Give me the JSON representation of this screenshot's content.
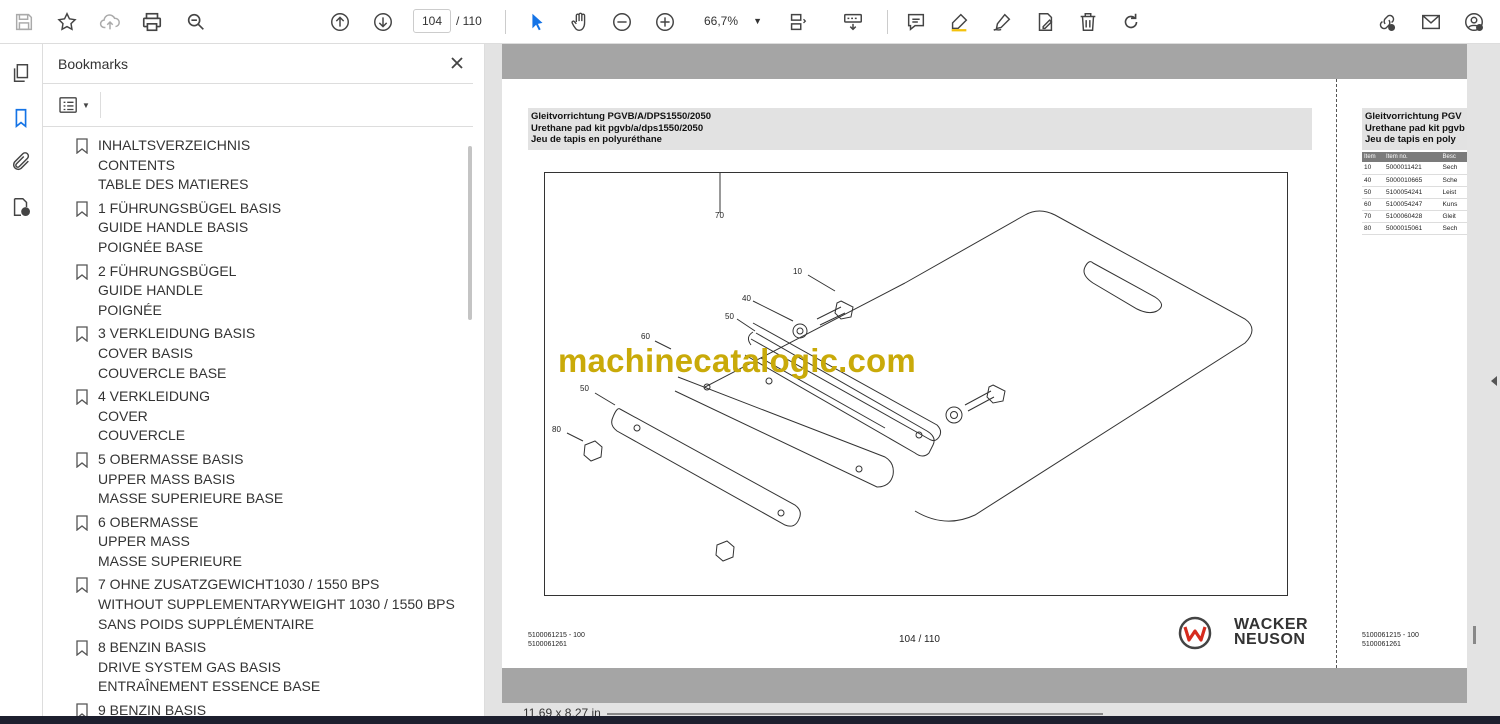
{
  "toolbar": {
    "page_current": "104",
    "page_total": "/  110",
    "zoom": "66,7%",
    "icons": [
      "save-icon",
      "star-icon",
      "cloud-upload-icon",
      "print-icon",
      "zoom-search-icon",
      "page-up-icon",
      "page-down-icon",
      "select-cursor-icon",
      "hand-icon",
      "zoom-out-icon",
      "zoom-in-icon",
      "fit-page-icon",
      "scroll-mode-icon",
      "comment-icon",
      "highlight-icon",
      "sign-icon",
      "edit-text-icon",
      "delete-icon",
      "rotate-icon",
      "link-share-icon",
      "mail-icon",
      "account-icon"
    ]
  },
  "left_rail": {
    "icons": [
      "pages-icon",
      "bookmark-icon",
      "attachment-icon",
      "document-security-icon"
    ]
  },
  "bookmarks_panel": {
    "title": "Bookmarks",
    "items": [
      {
        "lines": [
          "INHALTSVERZEICHNIS",
          "CONTENTS",
          "TABLE DES MATIERES"
        ]
      },
      {
        "lines": [
          "1 FÜHRUNGSBÜGEL BASIS",
          "GUIDE HANDLE BASIS",
          "POIGNÉE BASE"
        ]
      },
      {
        "lines": [
          "2 FÜHRUNGSBÜGEL",
          "GUIDE HANDLE",
          "POIGNÉE"
        ]
      },
      {
        "lines": [
          "3 VERKLEIDUNG BASIS",
          "COVER BASIS",
          "COUVERCLE BASE"
        ]
      },
      {
        "lines": [
          "4 VERKLEIDUNG",
          "COVER",
          "COUVERCLE"
        ]
      },
      {
        "lines": [
          "5 OBERMASSE BASIS",
          "UPPER MASS BASIS",
          "MASSE SUPERIEURE BASE"
        ]
      },
      {
        "lines": [
          "6 OBERMASSE",
          "UPPER MASS",
          "MASSE SUPERIEURE"
        ]
      },
      {
        "lines": [
          "7 OHNE ZUSATZGEWICHT1030 / 1550 BPS",
          "WITHOUT SUPPLEMENTARYWEIGHT 1030 / 1550 BPS",
          "SANS POIDS SUPPLÉMENTAIRE"
        ]
      },
      {
        "lines": [
          "8 BENZIN BASIS",
          "DRIVE SYSTEM GAS BASIS",
          "ENTRAÎNEMENT ESSENCE BASE"
        ]
      },
      {
        "lines": [
          "9 BENZIN BASIS"
        ]
      }
    ]
  },
  "document": {
    "header_lines": [
      "Gleitvorrichtung PGVB/A/DPS1550/2050",
      "Urethane pad kit pgvb/a/dps1550/2050",
      "Jeu de tapis en polyuréthane"
    ],
    "callouts": [
      "70",
      "10",
      "40",
      "50",
      "60",
      "50",
      "80"
    ],
    "footer_code": [
      "5100061215 - 100",
      "5100061261"
    ],
    "footer_page": "104 / 110",
    "logo_text": [
      "WACKER",
      "NEUSON"
    ],
    "watermark": "machinecatalogic.com",
    "next_page": {
      "header_lines": [
        "Gleitvorrichtung PGV",
        "Urethane pad kit pgvb",
        "Jeu de tapis en poly"
      ],
      "table_headers": [
        "Item",
        "Item no.",
        "Besc"
      ],
      "rows": [
        [
          "10",
          "5000011421",
          "Sech"
        ],
        [
          "40",
          "5000010665",
          "Sche"
        ],
        [
          "50",
          "5100054241",
          "Leist"
        ],
        [
          "60",
          "5100054247",
          "Kuns"
        ],
        [
          "70",
          "5100060428",
          "Gleit"
        ],
        [
          "80",
          "5000015061",
          "Sech"
        ]
      ],
      "footer_code": [
        "5100061215 - 100",
        "5100061261"
      ]
    }
  },
  "status": {
    "page_size": "11,69 x 8,27 in"
  }
}
